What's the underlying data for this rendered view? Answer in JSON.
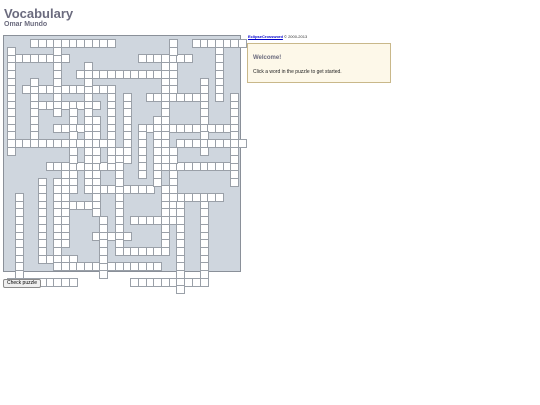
{
  "header": {
    "title": "Vocabulary",
    "author": "Omar Mundo"
  },
  "credit": {
    "link_text": "EclipseCrossword",
    "rest": " © 2000-2013"
  },
  "welcome": {
    "title": "Welcome!",
    "text": "Click a word in the puzzle to get started."
  },
  "controls": {
    "check_label": "Check puzzle"
  },
  "colors": {
    "board_bg": "#cfd6de",
    "cell_bg": "#ffffff",
    "title": "#6b6b7e",
    "panel_bg": "#fdf8e9"
  }
}
